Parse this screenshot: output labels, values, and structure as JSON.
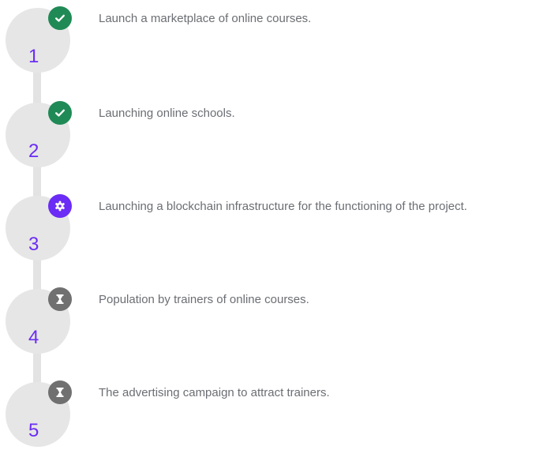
{
  "colors": {
    "circle": "#e6e6e6",
    "connector": "#e3e3e3",
    "number": "#6b2cf5",
    "done": "#1f8a55",
    "in_progress": "#6b2cf5",
    "pending": "#707070",
    "text": "#6b6e73"
  },
  "steps": [
    {
      "number": "1",
      "status": "done",
      "status_icon": "check-icon",
      "text": "Launch a marketplace of online courses."
    },
    {
      "number": "2",
      "status": "done",
      "status_icon": "check-icon",
      "text": "Launching online schools."
    },
    {
      "number": "3",
      "status": "in_progress",
      "status_icon": "gear-icon",
      "text": "Launching a blockchain infrastructure for the functioning of the project."
    },
    {
      "number": "4",
      "status": "pending",
      "status_icon": "hourglass-icon",
      "text": "Population by trainers of online courses."
    },
    {
      "number": "5",
      "status": "pending",
      "status_icon": "hourglass-icon",
      "text": "The advertising campaign to attract trainers."
    }
  ]
}
